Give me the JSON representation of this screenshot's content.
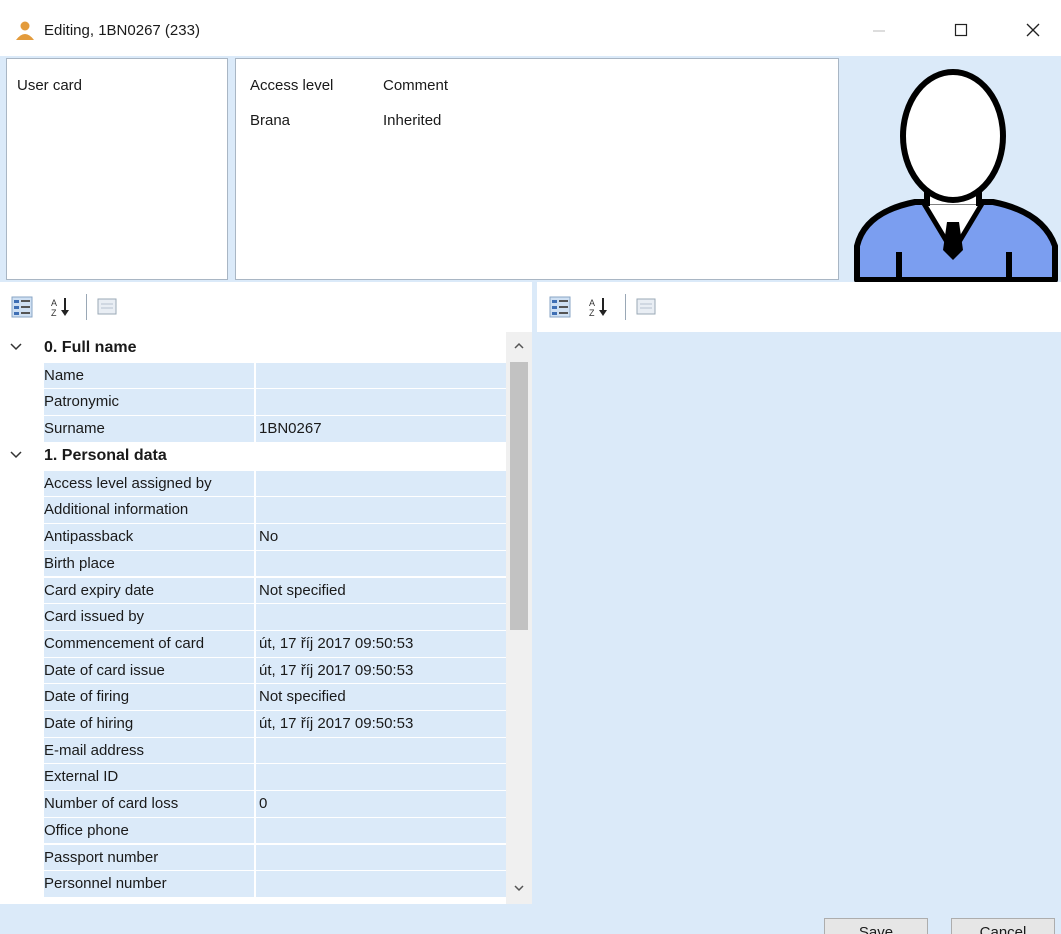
{
  "window": {
    "title": "Editing, 1BN0267 (233)",
    "icon": "user-person-icon"
  },
  "user_card": {
    "label": "User card"
  },
  "access_table": {
    "columns": [
      "Access level",
      "Comment"
    ],
    "rows": [
      {
        "access_level": "Brana",
        "comment": "Inherited"
      }
    ]
  },
  "avatar": {
    "icon": "user-silhouette-icon",
    "color": "#7b9ef0"
  },
  "toolbar": {
    "categorized_icon": "categorized-view-icon",
    "alphabetical_icon": "sort-alphabetical-icon",
    "property_pages_icon": "property-pages-icon"
  },
  "property_grid": {
    "categories": [
      {
        "label": "0. Full name",
        "expanded": true,
        "properties": [
          {
            "name": "Name",
            "value": ""
          },
          {
            "name": "Patronymic",
            "value": ""
          },
          {
            "name": "Surname",
            "value": "1BN0267"
          }
        ]
      },
      {
        "label": "1. Personal data",
        "expanded": true,
        "properties": [
          {
            "name": "Access level assigned by",
            "value": ""
          },
          {
            "name": "Additional information",
            "value": ""
          },
          {
            "name": "Antipassback",
            "value": "No"
          },
          {
            "name": "Birth place",
            "value": ""
          },
          {
            "name": "Card expiry date",
            "value": "Not specified"
          },
          {
            "name": "Card issued by",
            "value": ""
          },
          {
            "name": "Commencement of card",
            "value": "út, 17 říj 2017 09:50:53"
          },
          {
            "name": "Date of card issue",
            "value": "út, 17 říj 2017 09:50:53"
          },
          {
            "name": "Date of firing",
            "value": "Not specified"
          },
          {
            "name": "Date of hiring",
            "value": "út, 17 říj 2017 09:50:53"
          },
          {
            "name": "E-mail address",
            "value": ""
          },
          {
            "name": "External ID",
            "value": ""
          },
          {
            "name": "Number of card loss",
            "value": "0"
          },
          {
            "name": "Office phone",
            "value": ""
          },
          {
            "name": "Passport number",
            "value": ""
          },
          {
            "name": "Personnel number",
            "value": ""
          }
        ]
      }
    ]
  },
  "buttons": {
    "save": "Save",
    "cancel": "Cancel"
  },
  "colors": {
    "panel_bg": "#dbeaf9",
    "accent": "#7b9ef0"
  }
}
